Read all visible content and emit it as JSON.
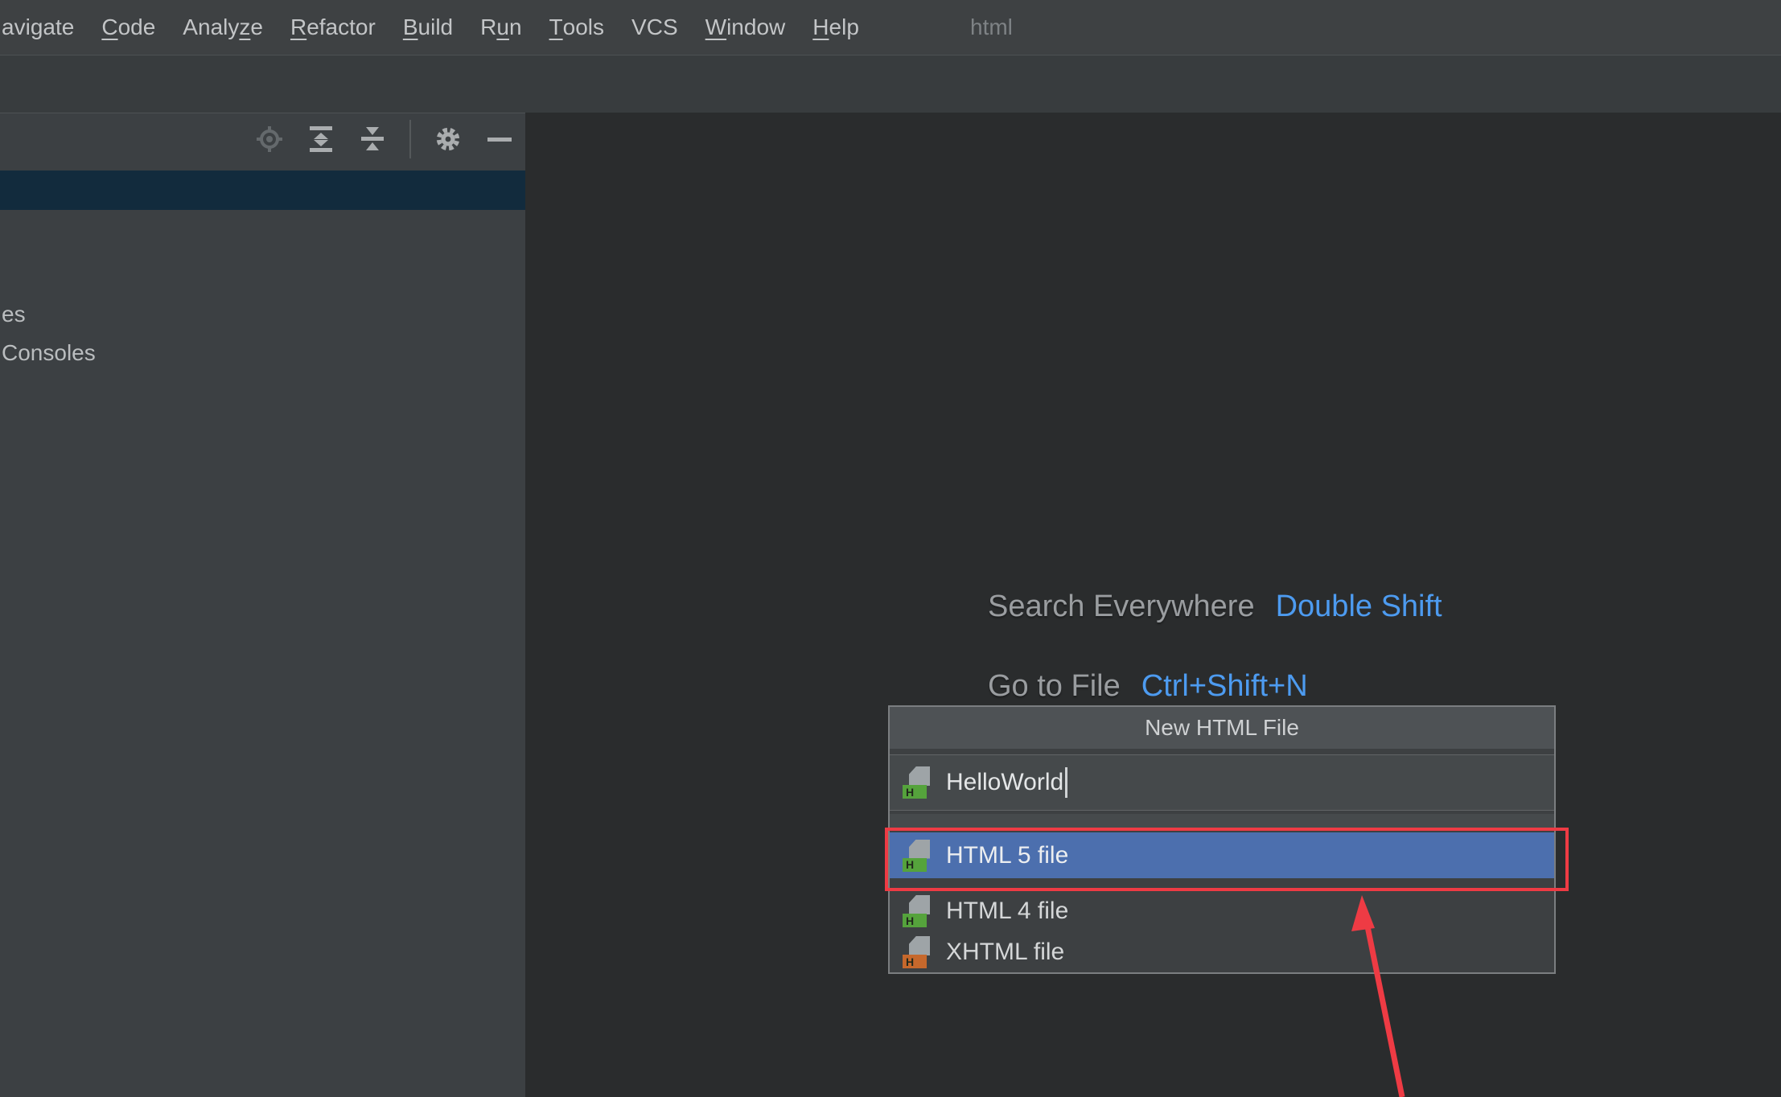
{
  "window": {
    "title": "html"
  },
  "menubar": {
    "items": [
      {
        "name": "navigate",
        "label": "avigate",
        "mnemonic_index": -1
      },
      {
        "name": "code",
        "label": "Code",
        "mnemonic_index": 0
      },
      {
        "name": "analyze",
        "label": "Analyze",
        "mnemonic_index": 5
      },
      {
        "name": "refactor",
        "label": "Refactor",
        "mnemonic_index": 0
      },
      {
        "name": "build",
        "label": "Build",
        "mnemonic_index": 0
      },
      {
        "name": "run",
        "label": "Run",
        "mnemonic_index": 1
      },
      {
        "name": "tools",
        "label": "Tools",
        "mnemonic_index": 0
      },
      {
        "name": "vcs",
        "label": "VCS",
        "mnemonic_index": -1
      },
      {
        "name": "window",
        "label": "Window",
        "mnemonic_index": 0
      },
      {
        "name": "help",
        "label": "Help",
        "mnemonic_index": 0
      }
    ]
  },
  "project_panel": {
    "toolbar": {
      "icons": [
        "locate",
        "expand-all",
        "collapse-all",
        "settings",
        "hide"
      ]
    },
    "tree": {
      "items": [
        "es",
        "Consoles"
      ]
    }
  },
  "editor_hints": [
    {
      "label": "Search Everywhere",
      "shortcut": "Double Shift"
    },
    {
      "label": "Go to File",
      "shortcut": "Ctrl+Shift+N"
    }
  ],
  "dialog": {
    "title": "New HTML File",
    "input": {
      "value": "HelloWorld",
      "icon_letter": "H",
      "icon_color": "#55a33c"
    },
    "items": [
      {
        "label": "HTML 5 file",
        "icon_letter": "H",
        "icon_color": "#55a33c",
        "selected": true
      },
      {
        "label": "HTML 4 file",
        "icon_letter": "H",
        "icon_color": "#55a33c",
        "selected": false
      },
      {
        "label": "XHTML file",
        "icon_letter": "H",
        "icon_color": "#c6682c",
        "selected": false
      }
    ]
  },
  "annotations": {
    "box_color": "#ee3b44",
    "arrow_color": "#ee3b44"
  },
  "colors": {
    "menubar_bg": "#3e4143",
    "panel_bg": "#3c4043",
    "editor_bg": "#2a2c2d",
    "dialog_bg": "#3d4042",
    "dialog_titlebar_bg": "#4e5255",
    "selection_blue": "#4c6fae",
    "tree_selection_navy": "#122b3d",
    "shortcut_blue": "#4d9bf0",
    "annotation_red": "#ee3b44"
  }
}
